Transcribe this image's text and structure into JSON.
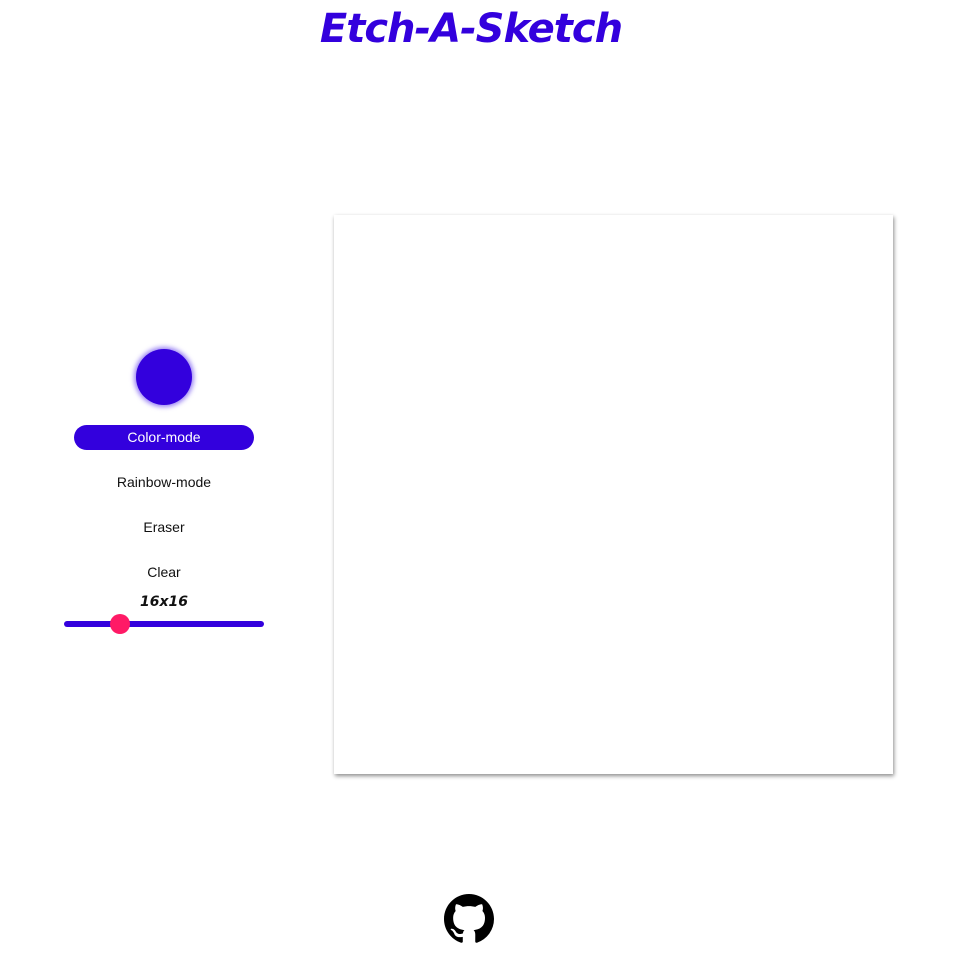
{
  "header": {
    "title": "Etch-A-Sketch"
  },
  "controls": {
    "color_picker": {
      "value": "#3300dd"
    },
    "buttons": {
      "color_mode": "Color-mode",
      "rainbow_mode": "Rainbow-mode",
      "eraser": "Eraser",
      "clear": "Clear"
    },
    "active_mode": "color_mode",
    "grid_size": {
      "label": "16x16",
      "value": 16,
      "slider_fraction": 0.28
    }
  },
  "board": {
    "background": "#ffffff"
  },
  "footer": {
    "icon": "github-icon"
  },
  "colors": {
    "accent": "#3300dd",
    "slider_thumb": "#ff1a66"
  }
}
